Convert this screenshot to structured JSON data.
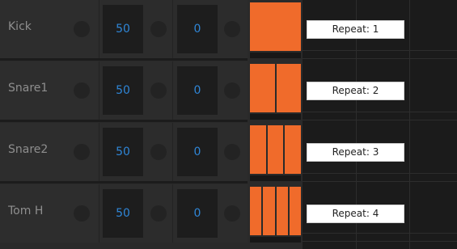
{
  "tracks": [
    {
      "name": "Kick",
      "value1": "50",
      "value2": "0",
      "repeat_label": "Repeat: 1",
      "divisions": 1
    },
    {
      "name": "Snare1",
      "value1": "50",
      "value2": "0",
      "repeat_label": "Repeat: 2",
      "divisions": 2
    },
    {
      "name": "Snare2",
      "value1": "50",
      "value2": "0",
      "repeat_label": "Repeat: 3",
      "divisions": 3
    },
    {
      "name": "Tom H",
      "value1": "50",
      "value2": "0",
      "repeat_label": "Repeat: 4",
      "divisions": 4
    }
  ],
  "colors": {
    "accent": "#f06b2b",
    "value_text": "#2f86d7",
    "label_text": "#8e8e8e"
  }
}
